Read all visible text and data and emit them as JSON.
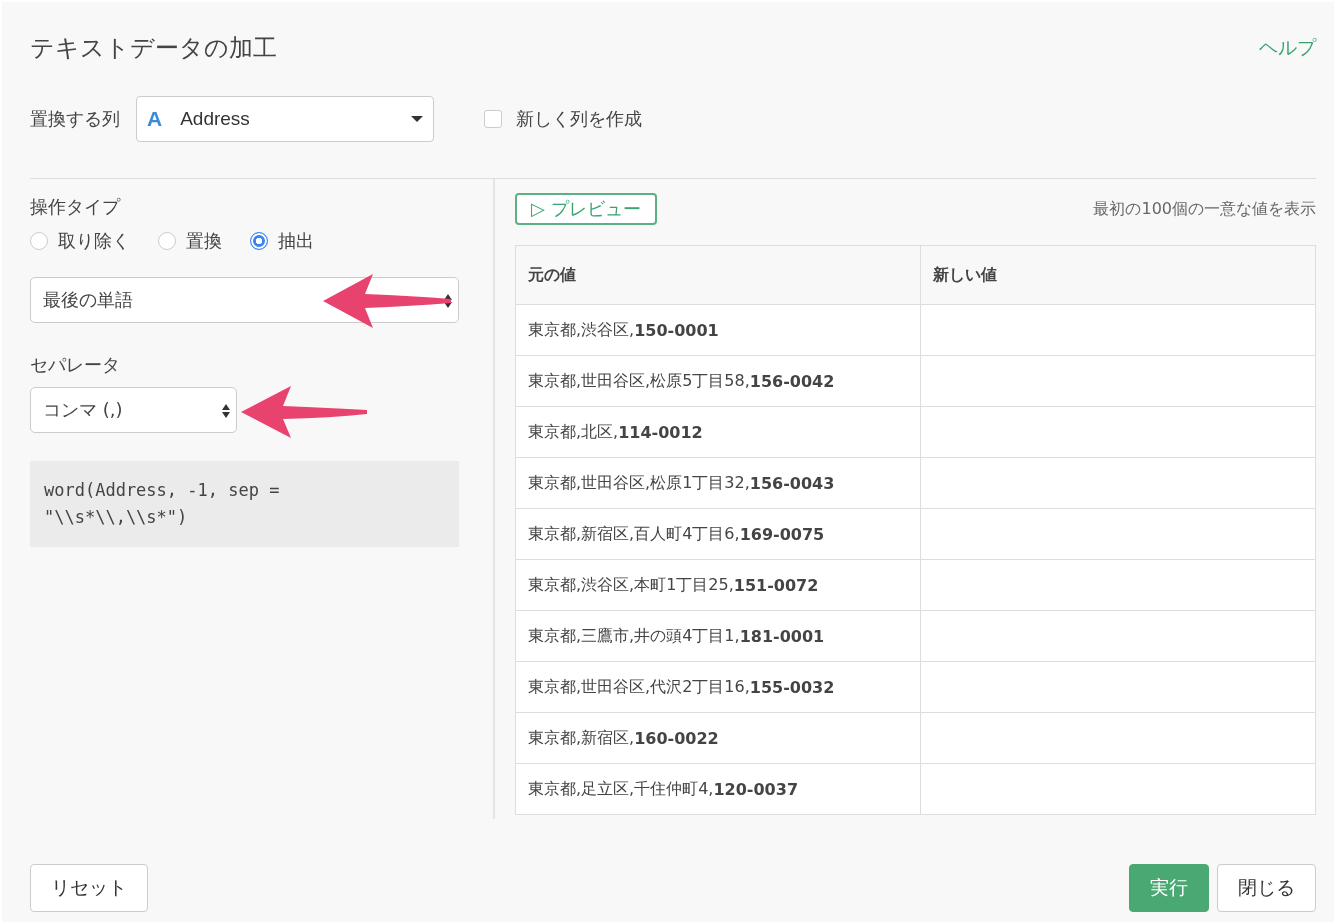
{
  "dialog": {
    "title": "テキストデータの加工",
    "help_link": "ヘルプ"
  },
  "column_select": {
    "label": "置換する列",
    "type_icon": "A",
    "value": "Address"
  },
  "new_column": {
    "label": "新しく列を作成",
    "checked": false
  },
  "operation": {
    "label": "操作タイプ",
    "options": [
      {
        "label": "取り除く",
        "selected": false
      },
      {
        "label": "置換",
        "selected": false
      },
      {
        "label": "抽出",
        "selected": true
      }
    ],
    "select_value": "最後の単語"
  },
  "separator": {
    "label": "セパレータ",
    "value": "コンマ (,)"
  },
  "code": "word(Address, -1, sep =\n\"\\\\s*\\\\,\\\\s*\")",
  "preview": {
    "button": "▷ プレビュー",
    "note": "最初の100個の一意な値を表示"
  },
  "table": {
    "columns": [
      "元の値",
      "新しい値"
    ],
    "rows": [
      {
        "original": "東京都,渋谷区,**150-0001**"
      },
      {
        "original": "東京都,世田谷区,松原5丁目58,**156-0042**"
      },
      {
        "original": "東京都,北区,**114-0012**"
      },
      {
        "original": "東京都,世田谷区,松原1丁目32,**156-0043**"
      },
      {
        "original": "東京都,新宿区,百人町4丁目6,**169-0075**"
      },
      {
        "original": "東京都,渋谷区,本町1丁目25,**151-0072**"
      },
      {
        "original": "東京都,三鷹市,井の頭4丁目1,**181-0001**"
      },
      {
        "original": "東京都,世田谷区,代沢2丁目16,**155-0032**"
      },
      {
        "original": "東京都,新宿区,**160-0022**"
      },
      {
        "original": "東京都,足立区,千住仲町4,**120-0037**"
      }
    ]
  },
  "buttons": {
    "reset": "リセット",
    "run": "実行",
    "close": "閉じる"
  }
}
